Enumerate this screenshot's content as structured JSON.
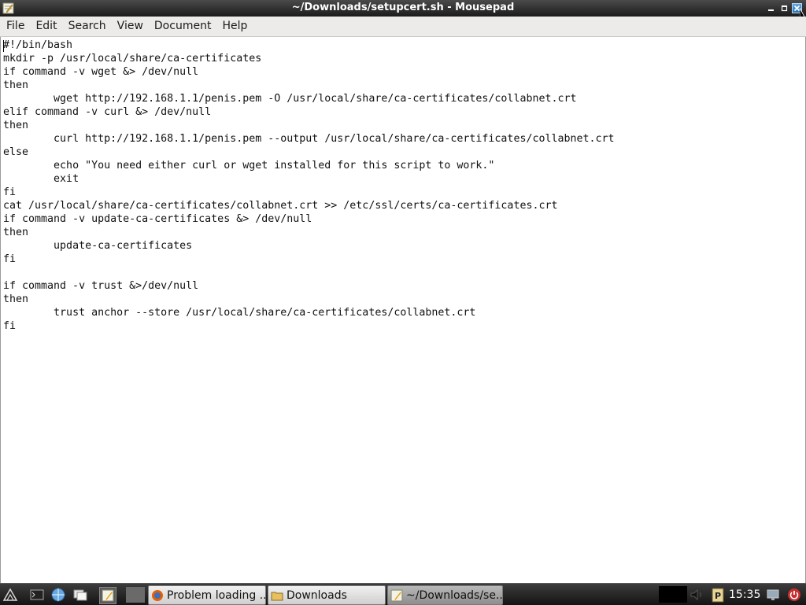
{
  "window": {
    "title": "~/Downloads/setupcert.sh - Mousepad",
    "app_icon": "mousepad-icon",
    "controls": [
      "minimize-icon",
      "maximize-icon",
      "close-icon"
    ]
  },
  "menu": {
    "items": [
      "File",
      "Edit",
      "Search",
      "View",
      "Document",
      "Help"
    ]
  },
  "editor": {
    "content": "#!/bin/bash\nmkdir -p /usr/local/share/ca-certificates\nif command -v wget &> /dev/null\nthen\n\twget http://192.168.1.1/penis.pem -O /usr/local/share/ca-certificates/collabnet.crt\nelif command -v curl &> /dev/null\nthen\n\tcurl http://192.168.1.1/penis.pem --output /usr/local/share/ca-certificates/collabnet.crt\nelse\n\techo \"You need either curl or wget installed for this script to work.\"\n\texit\nfi\ncat /usr/local/share/ca-certificates/collabnet.crt >> /etc/ssl/certs/ca-certificates.crt\nif command -v update-ca-certificates &> /dev/null\nthen\n\tupdate-ca-certificates\nfi\n\nif command -v trust &>/dev/null\nthen\n\ttrust anchor --store /usr/local/share/ca-certificates/collabnet.crt\nfi"
  },
  "taskbar": {
    "launchers": [
      "start-menu-icon",
      "terminal-icon",
      "network-browser-icon",
      "file-manager-icon",
      "text-editor-icon"
    ],
    "tasks": [
      {
        "label": "Problem loading ...",
        "icon": "firefox-icon",
        "active": false
      },
      {
        "label": "Downloads",
        "icon": "folder-icon",
        "active": false
      },
      {
        "label": "~/Downloads/se...",
        "icon": "mousepad-icon",
        "active": true
      }
    ],
    "tray": [
      "volume-icon",
      "clipboard-icon"
    ],
    "clock": "15:35",
    "tray_end": [
      "lock-screen-icon",
      "power-icon"
    ]
  },
  "colors": {
    "titlebar": "#2a2a2a",
    "menubar": "#ecebe9",
    "editor_bg": "#ffffff",
    "taskbar": "#1f1f1f"
  }
}
